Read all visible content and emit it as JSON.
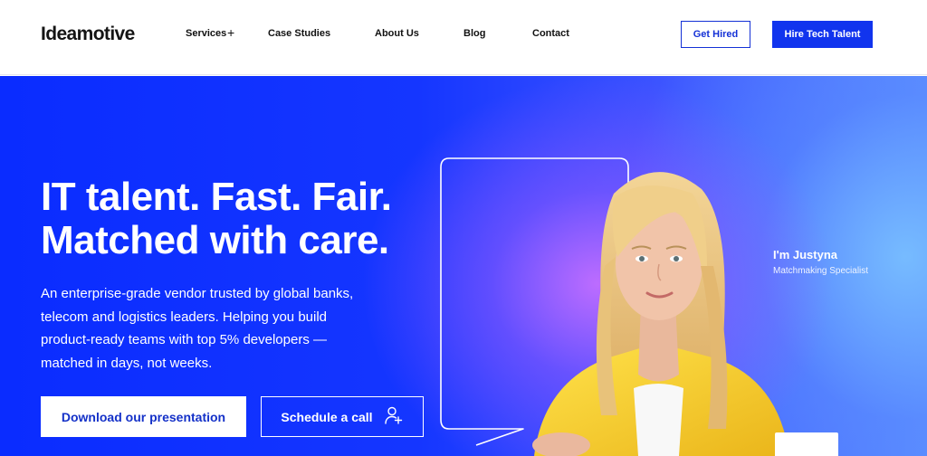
{
  "header": {
    "logo": "Ideamotive",
    "nav": [
      "Services",
      "Case Studies",
      "About Us",
      "Blog",
      "Contact"
    ],
    "services_expand_symbol": "+",
    "get_hired": "Get Hired",
    "hire_talent": "Hire Tech Talent"
  },
  "hero": {
    "title_line1": "IT talent. Fast. Fair.",
    "title_line2": "Matched with care.",
    "description": "An enterprise-grade vendor trusted by global banks, telecom and logistics leaders. Helping you build product-ready teams with top 5% developers — matched in days, not weeks.",
    "download_button": "Download our presentation",
    "schedule_button": "Schedule a call",
    "specialist_name": "I'm Justyna",
    "specialist_role": "Matchmaking Specialist"
  },
  "icons": {
    "schedule": "user-plus-icon",
    "nav_expand": "plus-icon"
  },
  "colors": {
    "brand_blue": "#1134ee",
    "hero_blue": "#0a2cff",
    "jacket_yellow": "#f4cf22"
  }
}
